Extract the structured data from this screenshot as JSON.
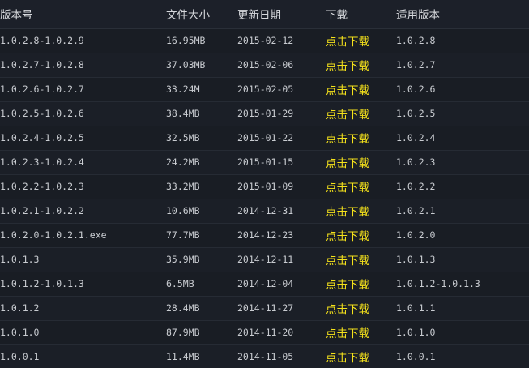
{
  "table": {
    "headers": {
      "version": "版本号",
      "size": "文件大小",
      "date": "更新日期",
      "download": "下载",
      "applies": "适用版本"
    },
    "rows": [
      {
        "version": "1.0.2.8-1.0.2.9",
        "size": "16.95MB",
        "date": "2015-02-12",
        "download": "点击下载",
        "applies": "1.0.2.8"
      },
      {
        "version": "1.0.2.7-1.0.2.8",
        "size": "37.03MB",
        "date": "2015-02-06",
        "download": "点击下载",
        "applies": "1.0.2.7"
      },
      {
        "version": "1.0.2.6-1.0.2.7",
        "size": "33.24M",
        "date": "2015-02-05",
        "download": "点击下载",
        "applies": "1.0.2.6"
      },
      {
        "version": "1.0.2.5-1.0.2.6",
        "size": "38.4MB",
        "date": "2015-01-29",
        "download": "点击下载",
        "applies": "1.0.2.5"
      },
      {
        "version": "1.0.2.4-1.0.2.5",
        "size": "32.5MB",
        "date": "2015-01-22",
        "download": "点击下载",
        "applies": "1.0.2.4"
      },
      {
        "version": "1.0.2.3-1.0.2.4",
        "size": "24.2MB",
        "date": "2015-01-15",
        "download": "点击下载",
        "applies": "1.0.2.3"
      },
      {
        "version": "1.0.2.2-1.0.2.3",
        "size": "33.2MB",
        "date": "2015-01-09",
        "download": "点击下载",
        "applies": "1.0.2.2"
      },
      {
        "version": "1.0.2.1-1.0.2.2",
        "size": "10.6MB",
        "date": "2014-12-31",
        "download": "点击下载",
        "applies": "1.0.2.1"
      },
      {
        "version": "1.0.2.0-1.0.2.1.exe",
        "size": "77.7MB",
        "date": "2014-12-23",
        "download": "点击下载",
        "applies": "1.0.2.0"
      },
      {
        "version": "1.0.1.3",
        "size": "35.9MB",
        "date": "2014-12-11",
        "download": "点击下载",
        "applies": "1.0.1.3"
      },
      {
        "version": "1.0.1.2-1.0.1.3",
        "size": "6.5MB",
        "date": "2014-12-04",
        "download": "点击下载",
        "applies": "1.0.1.2-1.0.1.3"
      },
      {
        "version": "1.0.1.2",
        "size": "28.4MB",
        "date": "2014-11-27",
        "download": "点击下载",
        "applies": "1.0.1.1"
      },
      {
        "version": "1.0.1.0",
        "size": "87.9MB",
        "date": "2014-11-20",
        "download": "点击下载",
        "applies": "1.0.1.0"
      },
      {
        "version": "1.0.0.1",
        "size": "11.4MB",
        "date": "2014-11-05",
        "download": "点击下载",
        "applies": "1.0.0.1"
      }
    ]
  },
  "colors": {
    "background": "#171b22",
    "text": "#c9ccd1",
    "download_link": "#f5e21b"
  }
}
